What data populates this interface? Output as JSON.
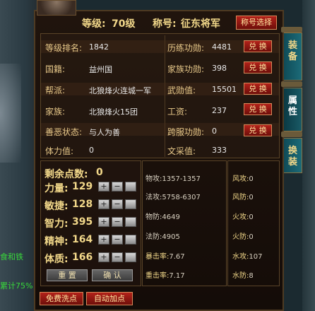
{
  "header": {
    "level_label": "等级:",
    "level_value": "70级",
    "title_label": "称号:",
    "title_value": "征东将军",
    "title_button": "称号选择"
  },
  "left_info": [
    {
      "label": "等级排名:",
      "value": "1842"
    },
    {
      "label": "国籍:",
      "value": "益州国"
    },
    {
      "label": "帮派:",
      "value": "北狼烽火连城一军"
    },
    {
      "label": "家族:",
      "value": "北狼烽火15团"
    },
    {
      "label": "善恶状态:",
      "value": "与人为善"
    },
    {
      "label": "体力值:",
      "value": "0"
    }
  ],
  "right_info": [
    {
      "label": "历练功勋:",
      "value": "4481",
      "button": "兑 换"
    },
    {
      "label": "家族功勋:",
      "value": "398",
      "button": "兑 换"
    },
    {
      "label": "武勋值:",
      "value": "15501",
      "button": "兑 换"
    },
    {
      "label": "工资:",
      "value": "237",
      "button": "兑 换"
    },
    {
      "label": "跨服功勋:",
      "value": "0",
      "button": "兑 换"
    },
    {
      "label": "文采值:",
      "value": "333"
    }
  ],
  "points": {
    "remaining_label": "剩余点数:",
    "remaining_value": "0",
    "attributes": [
      {
        "label": "力量:",
        "value": "129"
      },
      {
        "label": "敏捷:",
        "value": "128"
      },
      {
        "label": "智力:",
        "value": "395"
      },
      {
        "label": "精神:",
        "value": "164"
      },
      {
        "label": "体质:",
        "value": "166"
      }
    ],
    "plus": "+",
    "minus": "−",
    "reset_button": "重 置",
    "confirm_button": "确 认"
  },
  "combat_stats": [
    {
      "label": "物攻:",
      "value": "1357-1357"
    },
    {
      "label": "法攻:",
      "value": "5758-6307"
    },
    {
      "label": "物防:",
      "value": "4649"
    },
    {
      "label": "法防:",
      "value": "4905"
    },
    {
      "label": "暴击率:",
      "value": "7.67"
    },
    {
      "label": "重击率:",
      "value": "7.17"
    }
  ],
  "element_stats": [
    {
      "label": "风攻:",
      "value": "0"
    },
    {
      "label": "风防:",
      "value": "0"
    },
    {
      "label": "火攻:",
      "value": "0"
    },
    {
      "label": "火防:",
      "value": "0"
    },
    {
      "label": "水攻:",
      "value": "107"
    },
    {
      "label": "水防:",
      "value": "8"
    }
  ],
  "bottom_buttons": {
    "free_reset": "免费洗点",
    "auto_add": "自动加点"
  },
  "tabs": [
    "装备",
    "属性",
    "换装"
  ],
  "background_text": [
    "食和铁",
    "累计75%"
  ],
  "colors": {
    "gold": "#f2d88a",
    "button_red": "#b3221a",
    "tab_teal": "#1c6b78",
    "panel_bg": "#1a100a"
  }
}
